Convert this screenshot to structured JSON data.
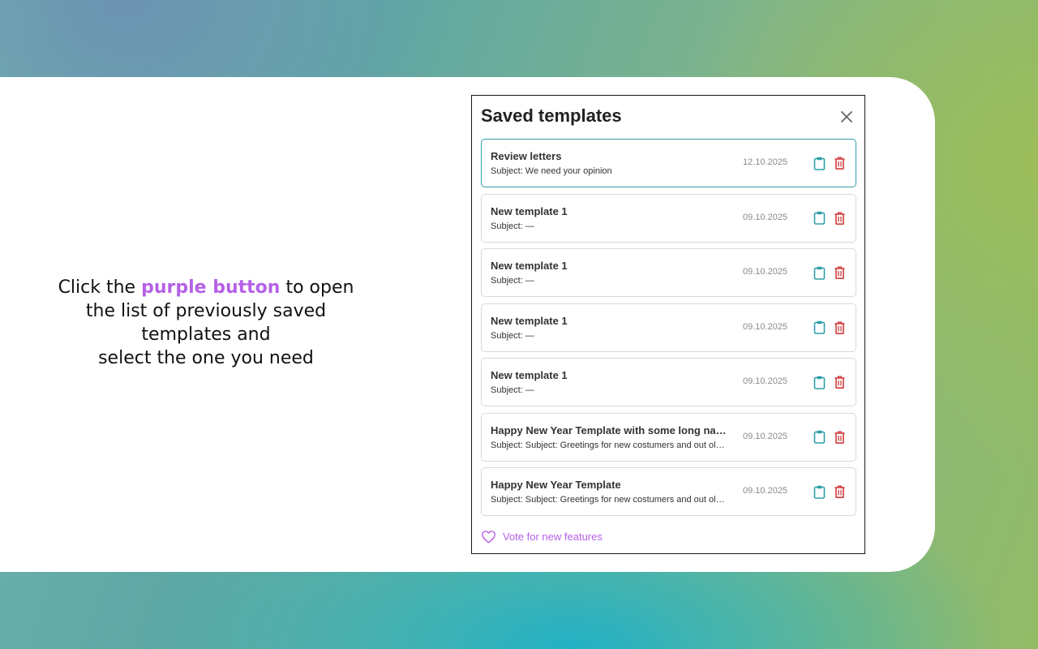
{
  "caption": {
    "before": "Click the",
    "highlight": "purple button",
    "after": "to open",
    "line2": "the list of previously saved",
    "line3": "templates and",
    "line4": "select the one you need"
  },
  "panel": {
    "title": "Saved templates",
    "close_icon": "close-icon",
    "vote_label": "Vote for new features",
    "vote_icon": "heart-icon"
  },
  "templates": [
    {
      "name": "Review letters",
      "subject": "Subject: We need your opinion",
      "date": "12.10.2025",
      "active": true
    },
    {
      "name": "New template 1",
      "subject": "Subject: —",
      "date": "09.10.2025"
    },
    {
      "name": "New template 1",
      "subject": "Subject: —",
      "date": "09.10.2025"
    },
    {
      "name": "New template 1",
      "subject": "Subject: —",
      "date": "09.10.2025"
    },
    {
      "name": "New template 1",
      "subject": "Subject: —",
      "date": "09.10.2025"
    },
    {
      "name": "Happy New Year Template with some long na…",
      "subject": "Subject: Subject: Greetings for new costumers and out ol…",
      "date": "09.10.2025"
    },
    {
      "name": "Happy New Year Template",
      "subject": "Subject: Subject: Greetings for new costumers and out ol…",
      "date": "09.10.2025"
    }
  ],
  "icons": {
    "copy": "clipboard-icon",
    "delete": "trash-icon"
  },
  "colors": {
    "accent_purple": "#b561e7",
    "copy_teal": "#2f9fa8",
    "delete_red": "#d23b3b",
    "active_border": "#2f9fa8"
  }
}
